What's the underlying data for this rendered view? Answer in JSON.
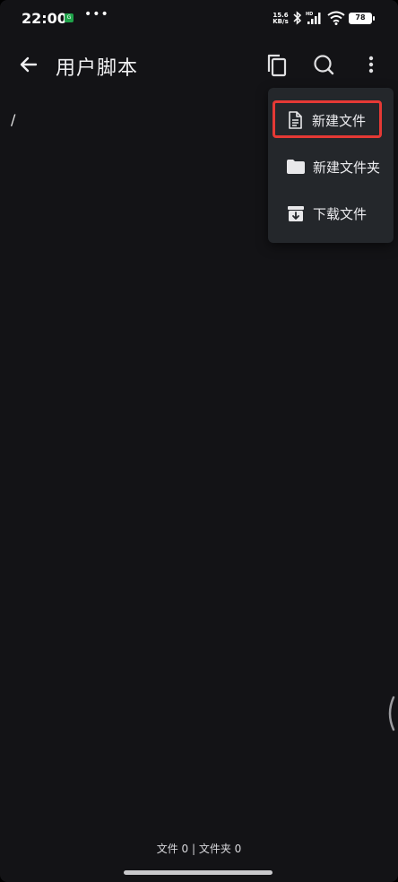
{
  "status_bar": {
    "time": "22:00",
    "app_icon_glyph": "G",
    "dots": "•••",
    "net_speed_value": "15.6",
    "net_speed_unit": "KB/s",
    "hd_label": "HD",
    "battery": "78"
  },
  "app_bar": {
    "title": "用户脚本",
    "icons": [
      "arrow-left-icon",
      "copy-icon",
      "search-icon",
      "more-vert-icon"
    ]
  },
  "path": "/",
  "menu": {
    "items": [
      {
        "label": "新建文件",
        "icon": "file-icon"
      },
      {
        "label": "新建文件夹",
        "icon": "folder-icon"
      },
      {
        "label": "下载文件",
        "icon": "download-box-icon"
      }
    ],
    "highlight_color": "#e53935"
  },
  "footer": {
    "stats": "文件 0 | 文件夹 0"
  },
  "colors": {
    "background": "#131316",
    "menu_background": "#24272b",
    "accent_green": "#1fa34a"
  }
}
